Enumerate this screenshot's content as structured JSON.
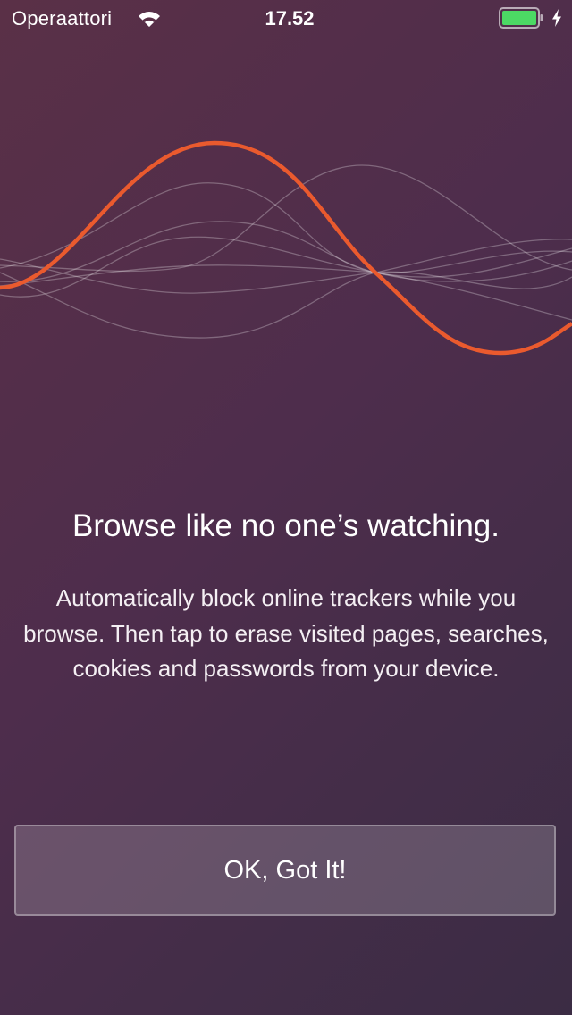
{
  "status_bar": {
    "carrier": "Operaattori",
    "time": "17.52",
    "battery_level": 1.0,
    "battery_color": "#4cd964",
    "icons": [
      "wifi-icon",
      "battery-icon",
      "charging-bolt-icon"
    ]
  },
  "hero": {
    "illustration": "waves-illustration",
    "accent_color": "#ea5a2e"
  },
  "onboarding": {
    "headline": "Browse like no one’s watching.",
    "description": "Automatically block online trackers while you browse. Then tap to erase visited pages, searches, cookies and passwords from your device.",
    "button_label": "OK, Got It!"
  }
}
